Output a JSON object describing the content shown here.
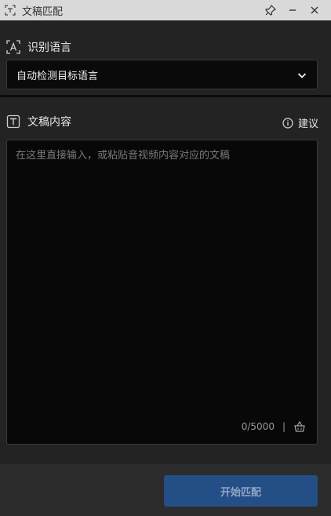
{
  "window": {
    "title": "文稿匹配",
    "controls": {
      "pin_icon": "pin-icon",
      "minimize_icon": "minimize-icon",
      "close_icon": "close-icon"
    }
  },
  "language": {
    "label": "识别语言",
    "selected": "自动检测目标语言"
  },
  "content": {
    "label": "文稿内容",
    "advice": "建议",
    "placeholder": "在这里直接输入，或粘贴音视频内容对应的文稿",
    "value": "",
    "counter": "0/5000",
    "separator": "|"
  },
  "footer": {
    "start_label": "开始匹配"
  },
  "colors": {
    "background": "#232323",
    "titlebar": "#d9d9d9",
    "field": "#0a0a0a",
    "primary_button": "#234e86",
    "primary_button_text": "#8fa6c4"
  }
}
